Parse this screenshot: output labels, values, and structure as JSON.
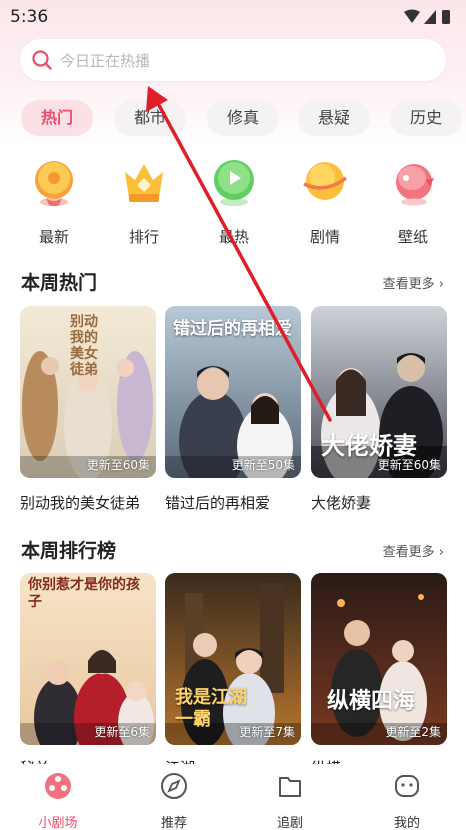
{
  "status": {
    "time": "5:36"
  },
  "search": {
    "placeholder": "今日正在热播"
  },
  "tabs": [
    {
      "label": "热门",
      "active": true
    },
    {
      "label": "都市"
    },
    {
      "label": "修真"
    },
    {
      "label": "悬疑"
    },
    {
      "label": "历史"
    }
  ],
  "categories": [
    {
      "label": "最新",
      "icon": "donut-icon"
    },
    {
      "label": "排行",
      "icon": "crown-icon"
    },
    {
      "label": "最热",
      "icon": "play-icon"
    },
    {
      "label": "剧情",
      "icon": "planet-icon"
    },
    {
      "label": "壁纸",
      "icon": "bird-icon"
    }
  ],
  "weekly_hot": {
    "title": "本周热门",
    "more": "查看更多",
    "items": [
      {
        "title": "别动我的美女徒弟",
        "episodes": "更新至60集",
        "poster_text": "别动我的美女徒弟"
      },
      {
        "title": "错过后的再相爱",
        "episodes": "更新至50集",
        "poster_text": "错过后的再相爱"
      },
      {
        "title": "大佬娇妻",
        "episodes": "更新至60集",
        "poster_text": "大佬娇妻"
      }
    ]
  },
  "weekly_rank": {
    "title": "本周排行榜",
    "more": "查看更多",
    "items": [
      {
        "title": "秘关",
        "episodes": "更新至6集",
        "poster_text": "你别惹才是你的孩子"
      },
      {
        "title": "江湖",
        "episodes": "更新至7集",
        "poster_text": "我是江湖一霸"
      },
      {
        "title": "纵横",
        "episodes": "更新至2集",
        "poster_text": "纵横四海"
      }
    ]
  },
  "bottom_nav": [
    {
      "label": "小剧场",
      "active": true
    },
    {
      "label": "推荐"
    },
    {
      "label": "追剧"
    },
    {
      "label": "我的"
    }
  ],
  "colors": {
    "accent": "#ee4d6c",
    "arrow": "#e11d2a"
  }
}
